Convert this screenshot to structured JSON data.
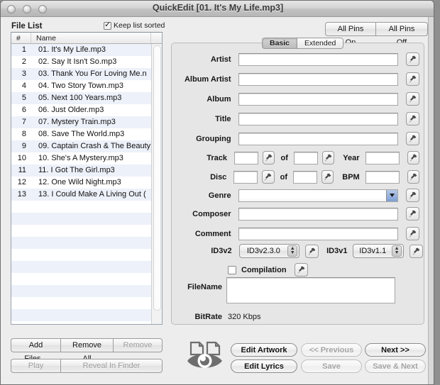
{
  "window": {
    "title": "QuickEdit [01. It's My Life.mp3]",
    "traffic_lights": [
      "close-button",
      "minimize-button",
      "zoom-button"
    ]
  },
  "filelist": {
    "label": "File List",
    "keep_sorted_label": "Keep list sorted",
    "keep_sorted_checked": true,
    "columns": [
      "#",
      "Name"
    ],
    "rows": [
      {
        "num": "1",
        "name": "01. It's My Life.mp3"
      },
      {
        "num": "2",
        "name": "02. Say It Isn't So.mp3"
      },
      {
        "num": "3",
        "name": "03. Thank You For Loving Me.n"
      },
      {
        "num": "4",
        "name": "04. Two Story Town.mp3"
      },
      {
        "num": "5",
        "name": "05. Next 100 Years.mp3"
      },
      {
        "num": "6",
        "name": "06. Just Older.mp3"
      },
      {
        "num": "7",
        "name": "07. Mystery Train.mp3"
      },
      {
        "num": "8",
        "name": "08. Save The World.mp3"
      },
      {
        "num": "9",
        "name": "09. Captain Crash & The Beauty"
      },
      {
        "num": "10",
        "name": "10. She's A Mystery.mp3"
      },
      {
        "num": "11",
        "name": "11. I Got The Girl.mp3"
      },
      {
        "num": "12",
        "name": "12. One Wild Night.mp3"
      },
      {
        "num": "13",
        "name": "13. I Could Make A Living Out ("
      }
    ]
  },
  "list_buttons": {
    "add_files": "Add Files...",
    "remove_all": "Remove All",
    "remove": "Remove",
    "play": "Play",
    "reveal_in_finder": "Reveal In Finder"
  },
  "pins": {
    "all_on": "All Pins On",
    "all_off": "All Pins Off"
  },
  "tabs": [
    {
      "label": "Basic",
      "active": true
    },
    {
      "label": "Extended",
      "active": false
    }
  ],
  "form": {
    "artist": {
      "label": "Artist",
      "value": ""
    },
    "album_artist": {
      "label": "Album Artist",
      "value": ""
    },
    "album": {
      "label": "Album",
      "value": ""
    },
    "title": {
      "label": "Title",
      "value": ""
    },
    "grouping": {
      "label": "Grouping",
      "value": ""
    },
    "track": {
      "label": "Track",
      "value": ""
    },
    "track_of": {
      "label": "of",
      "value": ""
    },
    "year": {
      "label": "Year",
      "value": ""
    },
    "disc": {
      "label": "Disc",
      "value": ""
    },
    "disc_of": {
      "label": "of",
      "value": ""
    },
    "bpm": {
      "label": "BPM",
      "value": ""
    },
    "genre": {
      "label": "Genre",
      "value": ""
    },
    "composer": {
      "label": "Composer",
      "value": ""
    },
    "comment": {
      "label": "Comment",
      "value": ""
    },
    "id3v2": {
      "label": "ID3v2",
      "value": "ID3v2.3.0"
    },
    "id3v1": {
      "label": "ID3v1",
      "value": "ID3v1.1"
    },
    "compilation": {
      "label": "Compilation",
      "checked": false
    },
    "filename": {
      "label": "FileName",
      "value": ""
    },
    "bitrate": {
      "label": "BitRate",
      "value": "320 Kbps"
    }
  },
  "actions": {
    "edit_artwork": {
      "label": "Edit Artwork",
      "enabled": true
    },
    "edit_lyrics": {
      "label": "Edit Lyrics",
      "enabled": true
    },
    "previous": {
      "label": "<< Previous",
      "enabled": false
    },
    "save": {
      "label": "Save",
      "enabled": false
    },
    "next": {
      "label": "Next >>",
      "enabled": true
    },
    "save_next": {
      "label": "Save &  Next",
      "enabled": false
    }
  },
  "icons": {
    "pin": "pin-icon",
    "preview": "preview-eye-icon"
  },
  "colors": {
    "window_bg": "#ededed",
    "panel_bg": "#e6e6e6",
    "row_stripe": "#edf1f9",
    "combo_arrow": "#7e9fd4"
  }
}
